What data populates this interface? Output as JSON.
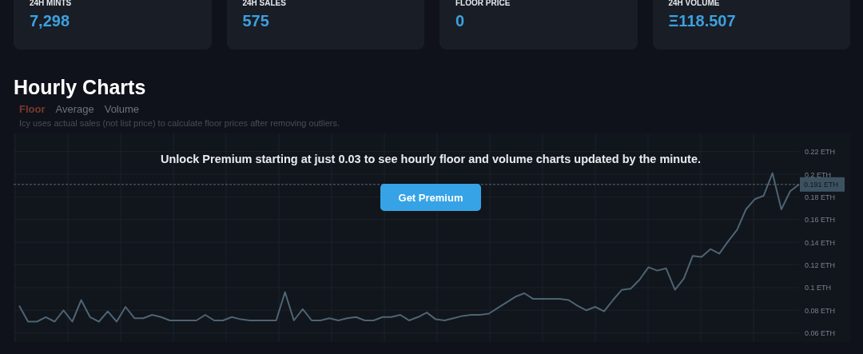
{
  "stats": [
    {
      "label": "24H MINTS",
      "value": "7,298"
    },
    {
      "label": "24H SALES",
      "value": "575"
    },
    {
      "label": "FLOOR PRICE",
      "value": "0"
    },
    {
      "label": "24H VOLUME",
      "value": "Ξ118.507"
    }
  ],
  "section_title": "Hourly Charts",
  "tabs": [
    {
      "label": "Floor",
      "selected": true
    },
    {
      "label": "Average",
      "selected": false
    },
    {
      "label": "Volume",
      "selected": false
    }
  ],
  "note": "Icy uses actual sales (not list price) to calculate floor prices after removing outliers.",
  "chart": {
    "premium_message": "Unlock Premium starting at just 0.03 to see hourly floor and volume charts updated by the minute.",
    "premium_button": "Get Premium",
    "chart_data": {
      "type": "line",
      "grid": true,
      "ylim": [
        0.052,
        0.236
      ],
      "ref_lines": [
        {
          "axis": "y",
          "value": 0.191,
          "label": "0.191 ETH"
        }
      ],
      "yticks": [
        {
          "value": 0.22,
          "label": "0.22 ETH"
        },
        {
          "value": 0.2,
          "label": "0.2 ETH"
        },
        {
          "value": 0.18,
          "label": "0.18 ETH"
        },
        {
          "value": 0.16,
          "label": "0.16 ETH"
        },
        {
          "value": 0.14,
          "label": "0.14 ETH"
        },
        {
          "value": 0.12,
          "label": "0.12 ETH"
        },
        {
          "value": 0.1,
          "label": "0.1 ETH"
        },
        {
          "value": 0.08,
          "label": "0.08 ETH"
        },
        {
          "value": 0.06,
          "label": "0.06 ETH"
        }
      ],
      "series": [
        {
          "color": "#4d6473",
          "values": [
            0.084,
            0.07,
            0.07,
            0.074,
            0.07,
            0.08,
            0.07,
            0.089,
            0.074,
            0.07,
            0.079,
            0.07,
            0.083,
            0.073,
            0.073,
            0.076,
            0.074,
            0.071,
            0.071,
            0.071,
            0.071,
            0.076,
            0.071,
            0.071,
            0.074,
            0.072,
            0.071,
            0.071,
            0.071,
            0.071,
            0.096,
            0.071,
            0.081,
            0.071,
            0.071,
            0.073,
            0.071,
            0.073,
            0.074,
            0.071,
            0.071,
            0.074,
            0.074,
            0.076,
            0.071,
            0.074,
            0.078,
            0.072,
            0.071,
            0.073,
            0.075,
            0.076,
            0.076,
            0.077,
            0.082,
            0.087,
            0.092,
            0.095,
            0.09,
            0.09,
            0.09,
            0.09,
            0.089,
            0.084,
            0.08,
            0.083,
            0.079,
            0.089,
            0.098,
            0.099,
            0.107,
            0.118,
            0.115,
            0.117,
            0.098,
            0.108,
            0.128,
            0.127,
            0.134,
            0.13,
            0.141,
            0.151,
            0.169,
            0.178,
            0.181,
            0.201,
            0.169,
            0.185,
            0.191
          ]
        }
      ]
    }
  }
}
